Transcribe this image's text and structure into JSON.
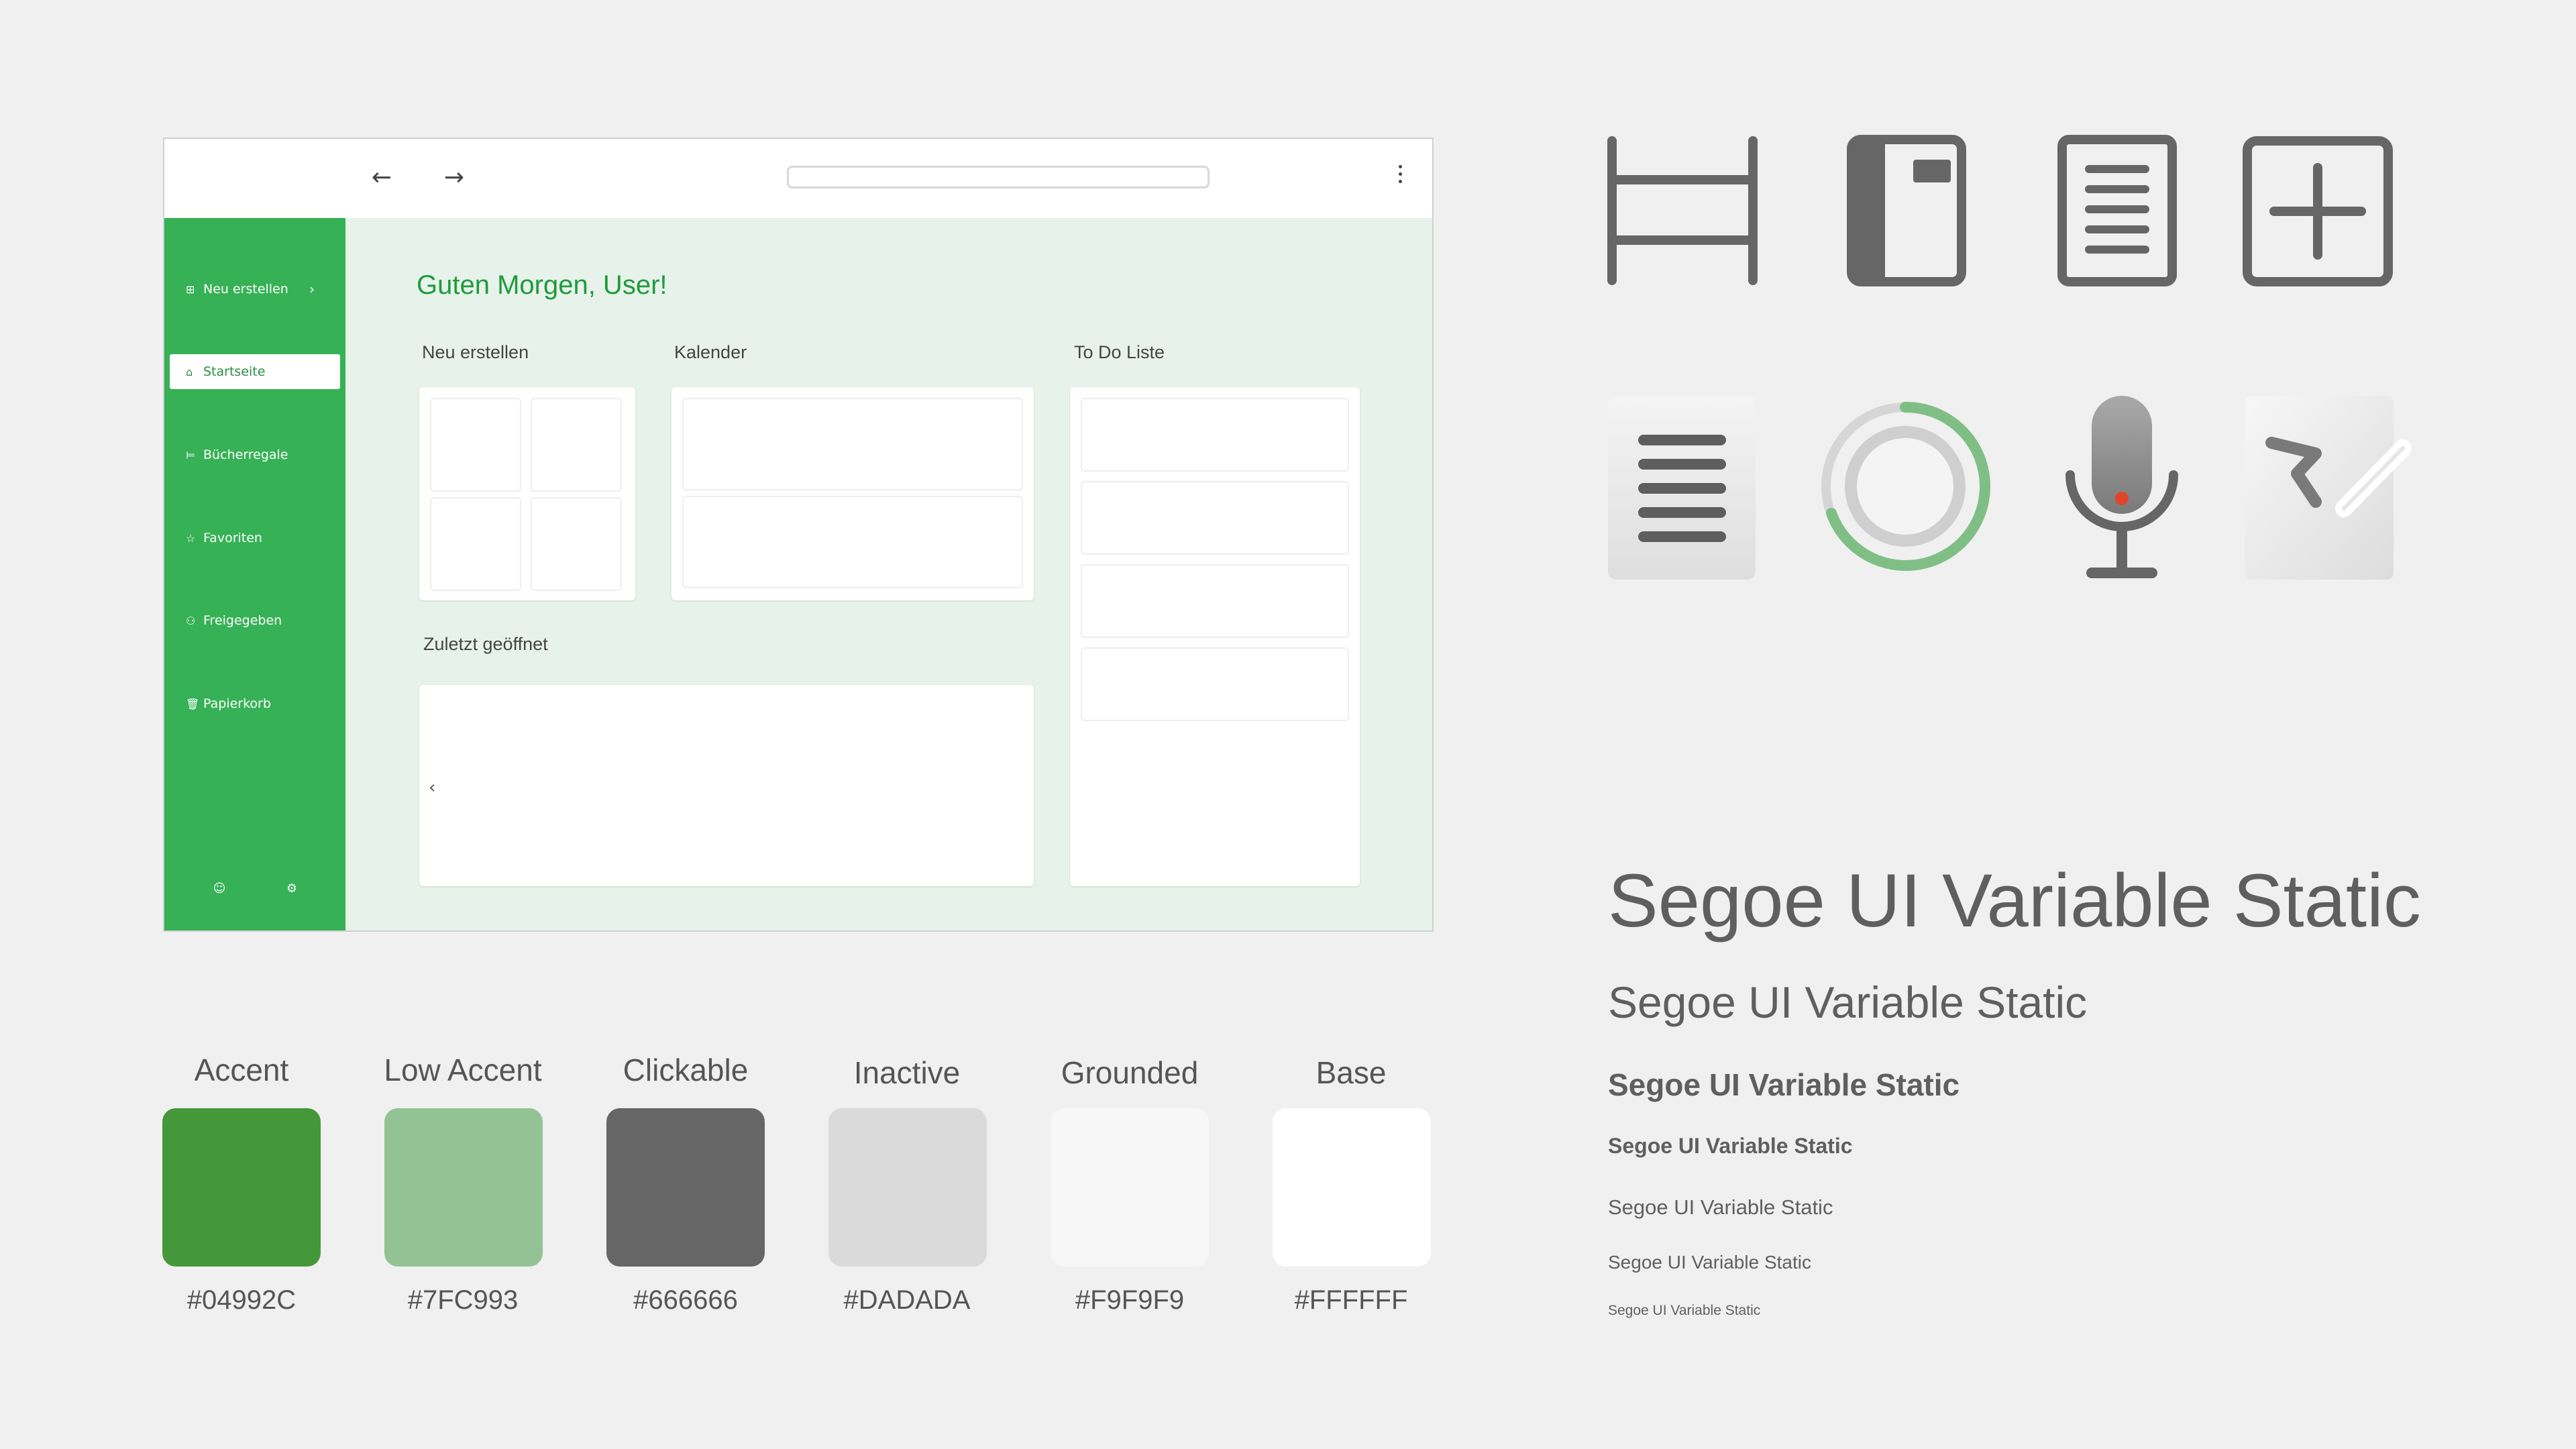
{
  "mockup": {
    "topbar": {
      "back_glyph": "←",
      "forward_glyph": "→",
      "address_value": ""
    },
    "sidebar": {
      "items": [
        {
          "label": "Neu erstellen",
          "icon": "new-document-icon",
          "glyph": "⊞",
          "chevron": "›"
        },
        {
          "label": "Startseite",
          "icon": "home-icon",
          "glyph": "⌂",
          "active": true
        },
        {
          "label": "Bücherregale",
          "icon": "bookshelf-icon",
          "glyph": "⊨"
        },
        {
          "label": "Favoriten",
          "icon": "star-icon",
          "glyph": "☆"
        },
        {
          "label": "Freigegeben",
          "icon": "people-icon",
          "glyph": "⚇"
        },
        {
          "label": "Papierkorb",
          "icon": "trash-icon",
          "glyph": "🗑"
        }
      ],
      "footer": {
        "account_glyph": "☺",
        "settings_glyph": "⚙"
      }
    },
    "main": {
      "greeting": "Guten Morgen, User!",
      "sections": {
        "new": "Neu erstellen",
        "calendar": "Kalender",
        "todo": "To Do Liste",
        "recent": "Zuletzt geöffnet"
      },
      "recent_prev_glyph": "‹"
    }
  },
  "icons": [
    "bookshelf-icon",
    "notebook-icon",
    "document-icon",
    "add-icon",
    "text-page-icon",
    "progress-ring-icon",
    "microphone-icon",
    "pen-sketch-icon"
  ],
  "palette": [
    {
      "name": "Accent",
      "hex": "#04992C",
      "color": "#44983a"
    },
    {
      "name": "Low Accent",
      "hex": "#7FC993",
      "color": "#93c395"
    },
    {
      "name": "Clickable",
      "hex": "#666666",
      "color": "#666666"
    },
    {
      "name": "Inactive",
      "hex": "#DADADA",
      "color": "#dadada"
    },
    {
      "name": "Grounded",
      "hex": "#F9F9F9",
      "color": "#f7f7f7"
    },
    {
      "name": "Base",
      "hex": "#FFFFFF",
      "color": "#ffffff"
    }
  ],
  "typography": {
    "samples": [
      "Segoe UI Variable Static",
      "Segoe UI Variable Static",
      "Segoe UI Variable Static",
      "Segoe UI Variable Static",
      "Segoe UI Variable Static",
      "Segoe UI Variable Static",
      "Segoe UI Variable Static"
    ]
  },
  "colors": {
    "accent": "#36b155",
    "accent_text": "#1f9a3c",
    "content_bg": "#e7f3ea",
    "icon_gray": "#666666"
  }
}
